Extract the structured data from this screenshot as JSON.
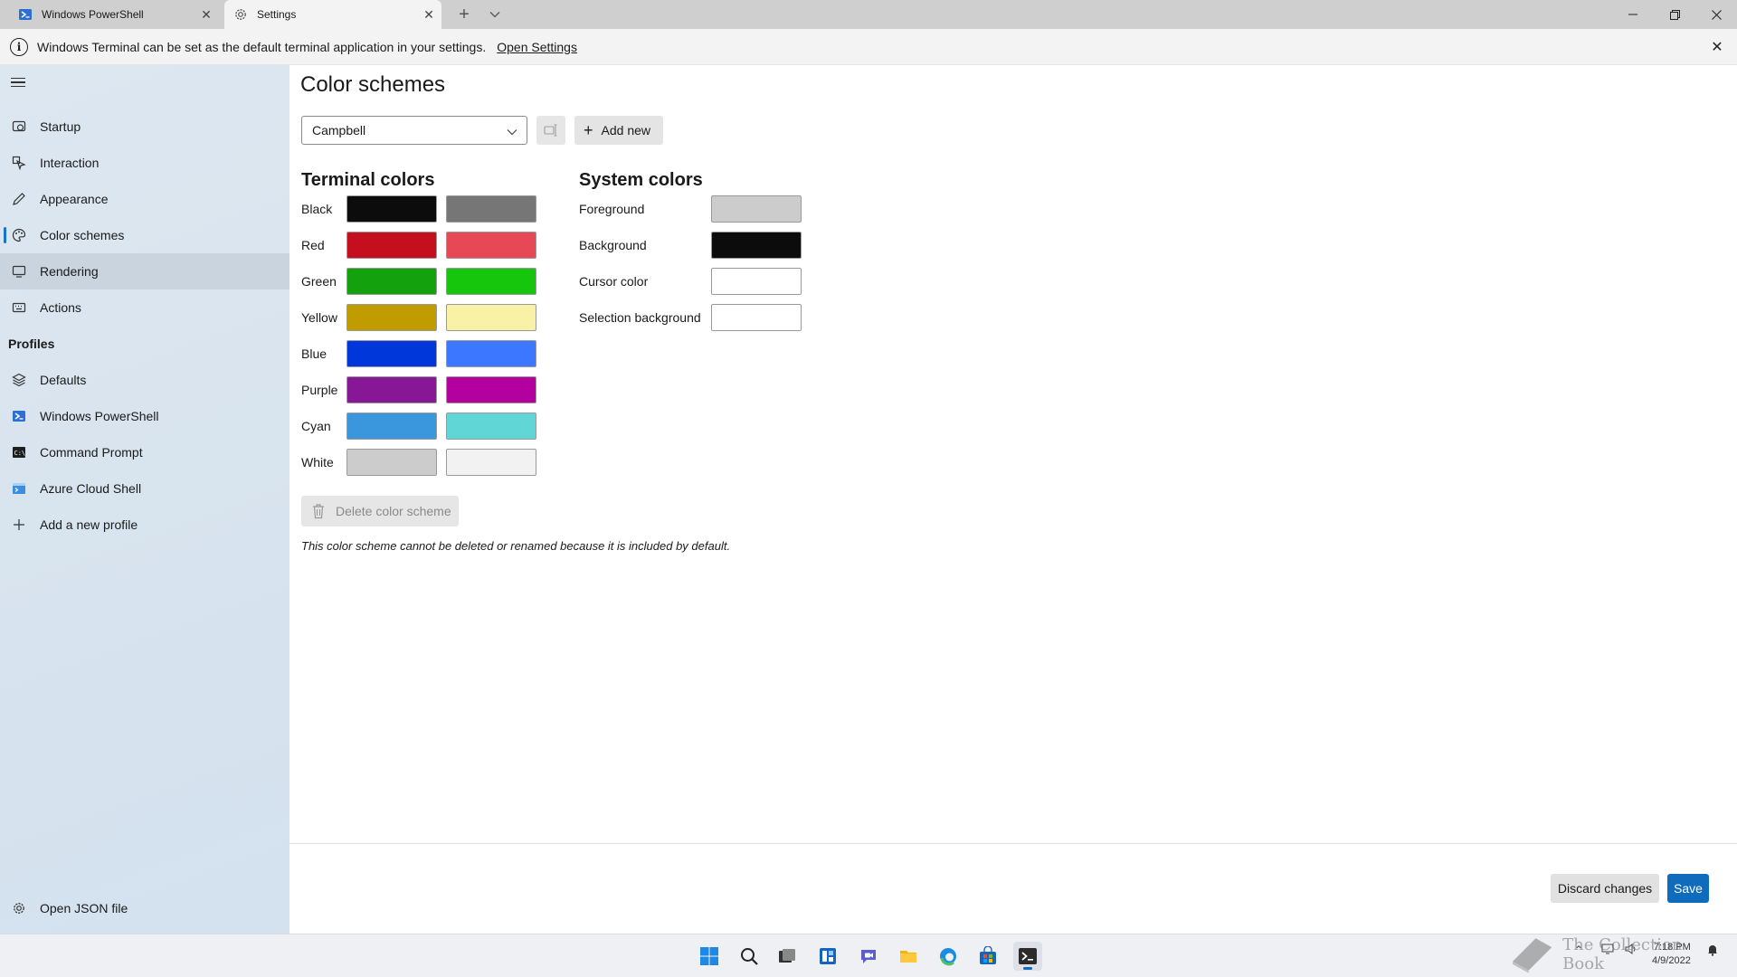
{
  "tabs": [
    {
      "label": "Windows PowerShell",
      "icon": "powershell-icon"
    },
    {
      "label": "Settings",
      "icon": "gear-icon"
    }
  ],
  "infobar": {
    "message": "Windows Terminal can be set as the default terminal application in your settings.",
    "link": "Open Settings"
  },
  "sidebar": {
    "items": [
      {
        "label": "Startup",
        "icon": "startup-icon"
      },
      {
        "label": "Interaction",
        "icon": "interaction-icon"
      },
      {
        "label": "Appearance",
        "icon": "pen-icon"
      },
      {
        "label": "Color schemes",
        "icon": "palette-icon"
      },
      {
        "label": "Rendering",
        "icon": "monitor-icon"
      },
      {
        "label": "Actions",
        "icon": "keyboard-icon"
      }
    ],
    "profiles_header": "Profiles",
    "profiles": [
      {
        "label": "Defaults",
        "icon": "layers-icon"
      },
      {
        "label": "Windows PowerShell",
        "icon": "powershell-icon"
      },
      {
        "label": "Command Prompt",
        "icon": "cmd-icon"
      },
      {
        "label": "Azure Cloud Shell",
        "icon": "azure-icon"
      },
      {
        "label": "Add a new profile",
        "icon": "plus-icon"
      }
    ],
    "open_json": "Open JSON file"
  },
  "main": {
    "title": "Color schemes",
    "selected_scheme": "Campbell",
    "add_new": "Add new",
    "terminal_colors_title": "Terminal colors",
    "terminal_colors": [
      {
        "name": "Black",
        "normal": "#0c0c0c",
        "bright": "#767676"
      },
      {
        "name": "Red",
        "normal": "#c50f1f",
        "bright": "#e74856"
      },
      {
        "name": "Green",
        "normal": "#13a10e",
        "bright": "#16c60c"
      },
      {
        "name": "Yellow",
        "normal": "#c19c00",
        "bright": "#f9f1a5"
      },
      {
        "name": "Blue",
        "normal": "#0037da",
        "bright": "#3b78ff"
      },
      {
        "name": "Purple",
        "normal": "#881798",
        "bright": "#b4009e"
      },
      {
        "name": "Cyan",
        "normal": "#3a96dd",
        "bright": "#61d6d6"
      },
      {
        "name": "White",
        "normal": "#cccccc",
        "bright": "#f2f2f2"
      }
    ],
    "system_colors_title": "System colors",
    "system_colors": [
      {
        "name": "Foreground",
        "color": "#cccccc"
      },
      {
        "name": "Background",
        "color": "#0c0c0c"
      },
      {
        "name": "Cursor color",
        "color": "#ffffff"
      },
      {
        "name": "Selection background",
        "color": "#ffffff"
      }
    ],
    "delete_label": "Delete color scheme",
    "delete_note": "This color scheme cannot be deleted or renamed because it is included by default."
  },
  "footer": {
    "discard": "Discard changes",
    "save": "Save"
  },
  "taskbar": {
    "time": "7:18 PM",
    "date": "4/9/2022",
    "accent": "#0f6cbd"
  },
  "watermark": "The Collection Book"
}
